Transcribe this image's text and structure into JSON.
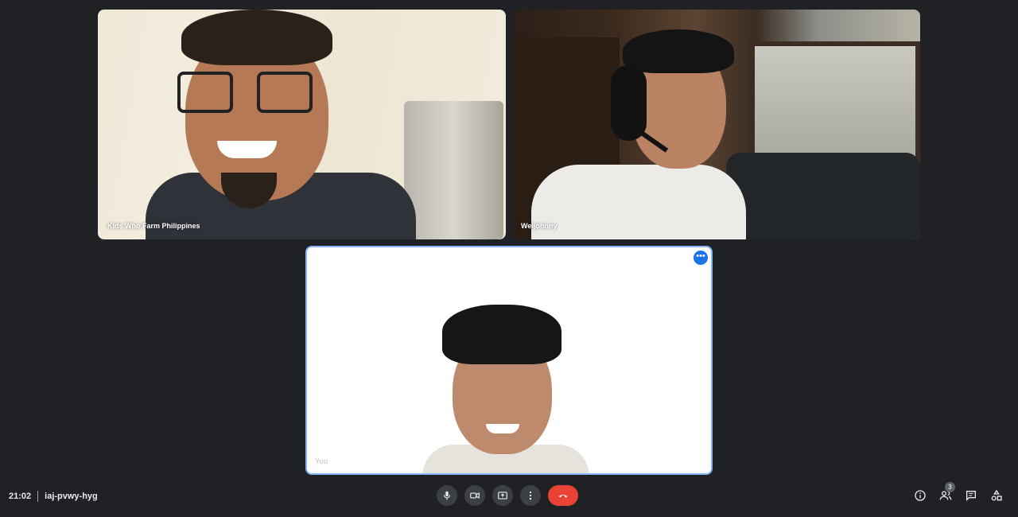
{
  "participants": [
    {
      "name": "Kids Who Farm Philippines"
    },
    {
      "name": "Weljohnny"
    },
    {
      "name": "You"
    }
  ],
  "meeting": {
    "time": "21:02",
    "code": "iaj-pvwy-hyg"
  },
  "more_options_glyph": "•••",
  "controls": [
    "microphone-icon",
    "camera-icon",
    "present-screen-icon",
    "more-options-icon",
    "end-call-icon"
  ],
  "right_tools": {
    "people_count": "3",
    "icons": [
      "info-icon",
      "people-icon",
      "chat-icon",
      "activities-icon"
    ]
  },
  "colors": {
    "background": "#202124",
    "control": "#3c4043",
    "end_call": "#ea4335",
    "accent": "#8ab4f8"
  }
}
